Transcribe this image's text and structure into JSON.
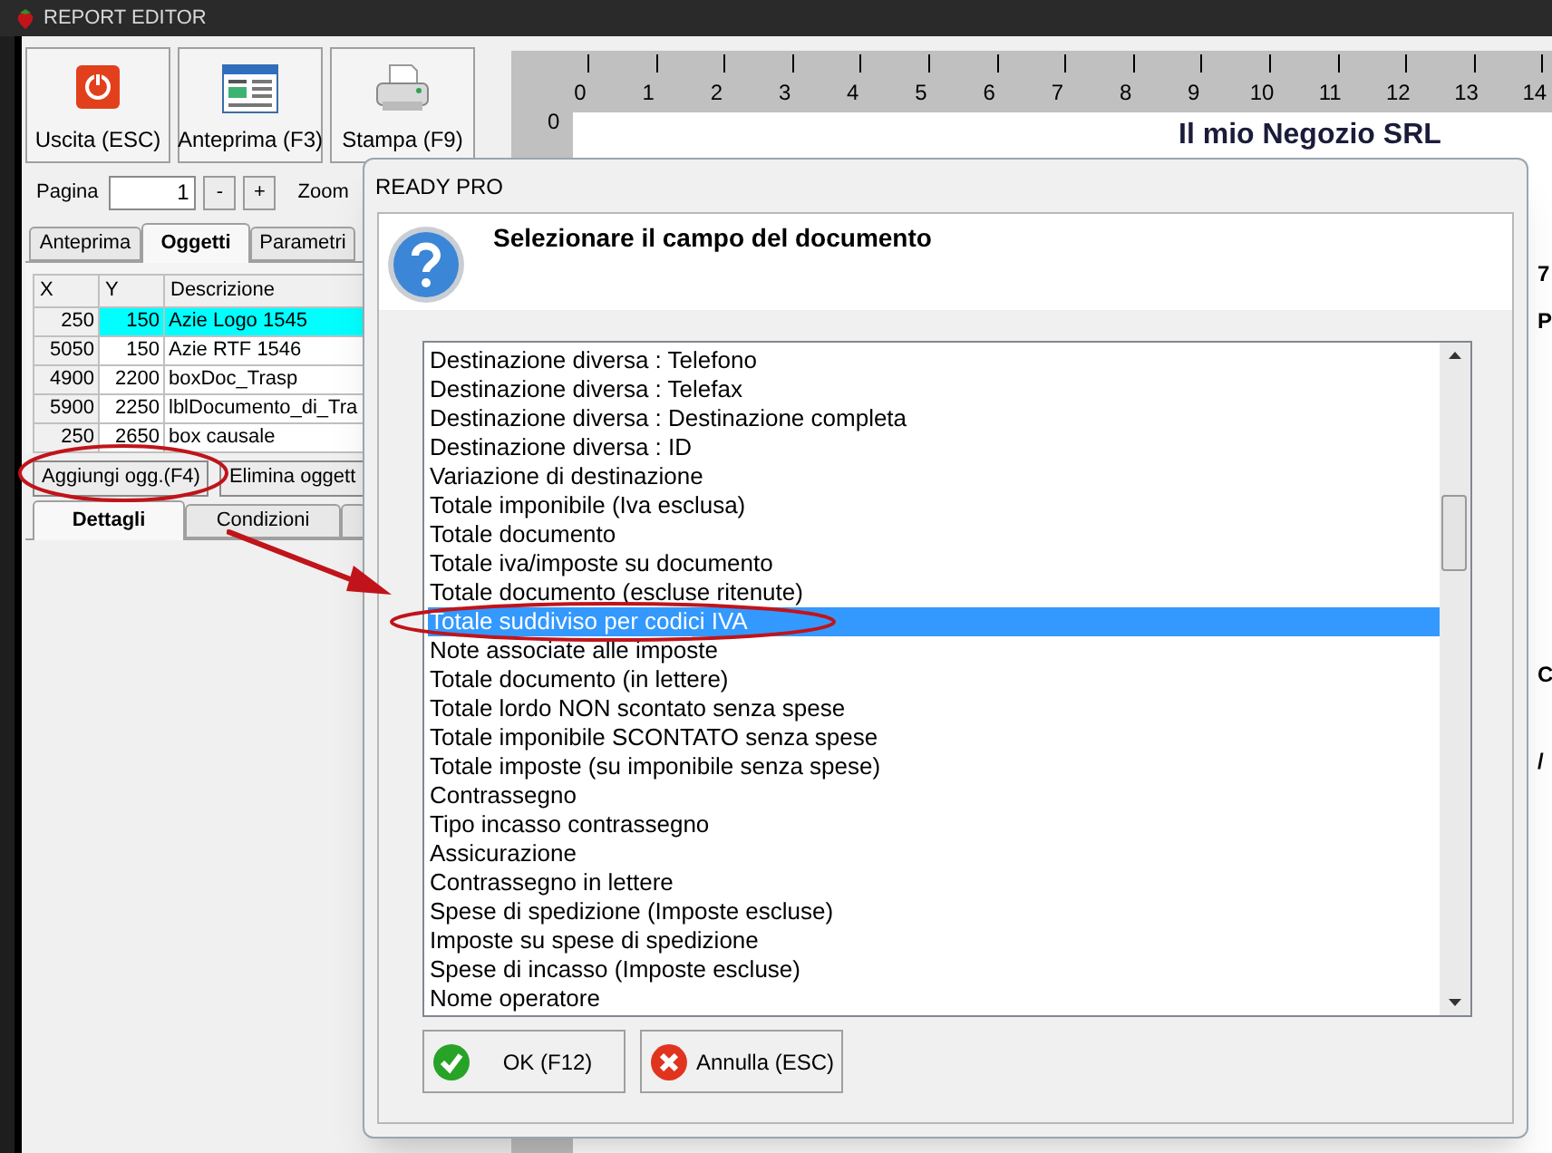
{
  "app_window": {
    "title": "REPORT EDITOR"
  },
  "toolbar": [
    {
      "label": "Uscita (ESC)",
      "kind": "exit"
    },
    {
      "label": "Anteprima (F3)",
      "kind": "preview"
    },
    {
      "label": "Stampa (F9)",
      "kind": "print"
    }
  ],
  "page_nav": {
    "label": "Pagina",
    "value": "1",
    "minus": "-",
    "plus": "+",
    "zoom_label": "Zoom"
  },
  "tabs": [
    {
      "label": "Anteprima",
      "selected": false
    },
    {
      "label": "Oggetti",
      "selected": true
    },
    {
      "label": "Parametri",
      "selected": false
    }
  ],
  "objects_table": {
    "columns": [
      "X",
      "Y",
      "Descrizione"
    ],
    "rows": [
      {
        "cells": [
          "250",
          "150",
          "Azie Logo 1545"
        ],
        "selected": true
      },
      {
        "cells": [
          "5050",
          "150",
          "Azie RTF 1546"
        ],
        "selected": false
      },
      {
        "cells": [
          "4900",
          "2200",
          "boxDoc_Trasp"
        ],
        "selected": false
      },
      {
        "cells": [
          "5900",
          "2250",
          "lblDocumento_di_Tra"
        ],
        "selected": false
      },
      {
        "cells": [
          "250",
          "2650",
          "box causale"
        ],
        "selected": false
      }
    ]
  },
  "object_buttons": [
    "Aggiungi ogg.(F4)",
    "Elimina oggett"
  ],
  "detail_tabs": [
    {
      "label": "Dettagli",
      "selected": true
    },
    {
      "label": "Condizioni",
      "selected": false
    },
    {
      "selected": false
    }
  ],
  "ruler": {
    "ticks": [
      "0",
      "1",
      "2",
      "3",
      "4",
      "5",
      "6",
      "7",
      "8",
      "9",
      "10",
      "11",
      "12",
      "13",
      "14"
    ],
    "side_label": "0"
  },
  "document": {
    "company": "Il mio Negozio SRL",
    "fragments": [
      "7",
      "P",
      "C",
      "/"
    ]
  },
  "dialog": {
    "title": "READY PRO",
    "heading": "Selezionare il campo del documento",
    "items": [
      {
        "label": "Destinazione diversa : Telefono",
        "selected": false
      },
      {
        "label": "Destinazione diversa : Telefax",
        "selected": false
      },
      {
        "label": "Destinazione diversa : Destinazione completa",
        "selected": false
      },
      {
        "label": "Destinazione diversa : ID",
        "selected": false
      },
      {
        "label": "Variazione di destinazione",
        "selected": false
      },
      {
        "label": "Totale imponibile (Iva esclusa)",
        "selected": false
      },
      {
        "label": "Totale documento",
        "selected": false
      },
      {
        "label": "Totale iva/imposte su documento",
        "selected": false
      },
      {
        "label": "Totale documento (escluse ritenute)",
        "selected": false
      },
      {
        "label": "Totale suddiviso per codici IVA",
        "selected": true
      },
      {
        "label": "Note associate alle imposte",
        "selected": false
      },
      {
        "label": "Totale documento (in lettere)",
        "selected": false
      },
      {
        "label": "Totale lordo NON scontato senza spese",
        "selected": false
      },
      {
        "label": "Totale imponibile SCONTATO senza spese",
        "selected": false
      },
      {
        "label": "Totale imposte (su imponibile senza spese)",
        "selected": false
      },
      {
        "label": "Contrassegno",
        "selected": false
      },
      {
        "label": "Tipo incasso contrassegno",
        "selected": false
      },
      {
        "label": "Assicurazione",
        "selected": false
      },
      {
        "label": "Contrassegno in lettere",
        "selected": false
      },
      {
        "label": "Spese di spedizione (Imposte escluse)",
        "selected": false
      },
      {
        "label": "Imposte su spese di spedizione",
        "selected": false
      },
      {
        "label": "Spese di incasso (Imposte escluse)",
        "selected": false
      },
      {
        "label": "Nome operatore",
        "selected": false
      }
    ],
    "buttons": [
      {
        "label": "OK (F12)",
        "kind": "ok"
      },
      {
        "label": "Annulla (ESC)",
        "kind": "cancel"
      }
    ]
  }
}
